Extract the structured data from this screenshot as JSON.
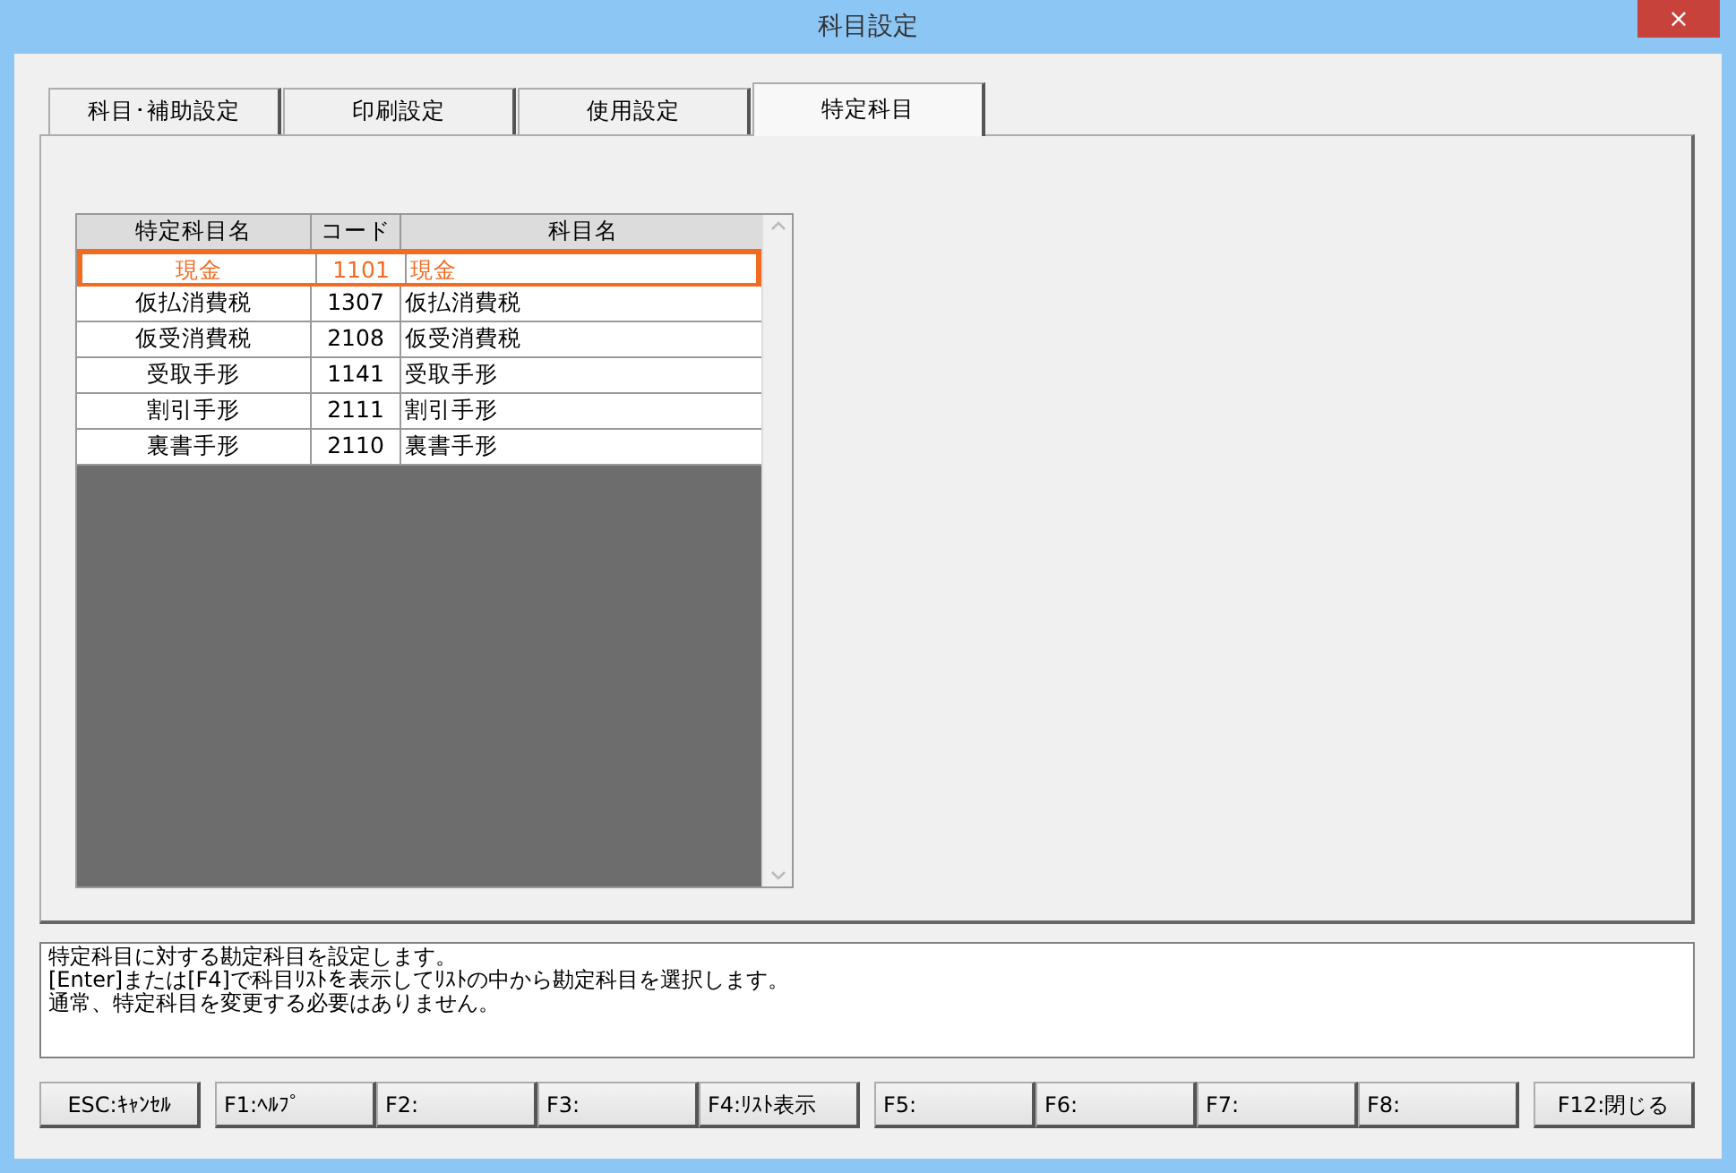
{
  "window": {
    "title": "科目設定",
    "close": "×"
  },
  "tabs": [
    {
      "label": "科目･補助設定",
      "selected": false
    },
    {
      "label": "印刷設定",
      "selected": false
    },
    {
      "label": "使用設定",
      "selected": false
    },
    {
      "label": "特定科目",
      "selected": true
    }
  ],
  "table": {
    "columns": [
      "特定科目名",
      "コード",
      "科目名"
    ],
    "rows": [
      {
        "cells": [
          "現金",
          "1101",
          "現金"
        ],
        "selected": true
      },
      {
        "cells": [
          "仮払消費税",
          "1307",
          "仮払消費税"
        ],
        "selected": false
      },
      {
        "cells": [
          "仮受消費税",
          "2108",
          "仮受消費税"
        ],
        "selected": false
      },
      {
        "cells": [
          "受取手形",
          "1141",
          "受取手形"
        ],
        "selected": false
      },
      {
        "cells": [
          "割引手形",
          "2111",
          "割引手形"
        ],
        "selected": false
      },
      {
        "cells": [
          "裏書手形",
          "2110",
          "裏書手形"
        ],
        "selected": false
      }
    ]
  },
  "message": [
    "特定科目に対する勘定科目を設定します。",
    "[Enter]または[F4]で科目ﾘｽﾄを表示してﾘｽﾄの中から勘定科目を選択します。",
    "通常、特定科目を変更する必要はありません。"
  ],
  "function_keys": [
    [
      "ESC:ｷｬﾝｾﾙ"
    ],
    [
      "F1:ﾍﾙﾌﾟ",
      "F2:",
      "F3:",
      "F4:ﾘｽﾄ表示"
    ],
    [
      "F5:",
      "F6:",
      "F7:",
      "F8:"
    ],
    [
      "F12:閉じる"
    ]
  ]
}
